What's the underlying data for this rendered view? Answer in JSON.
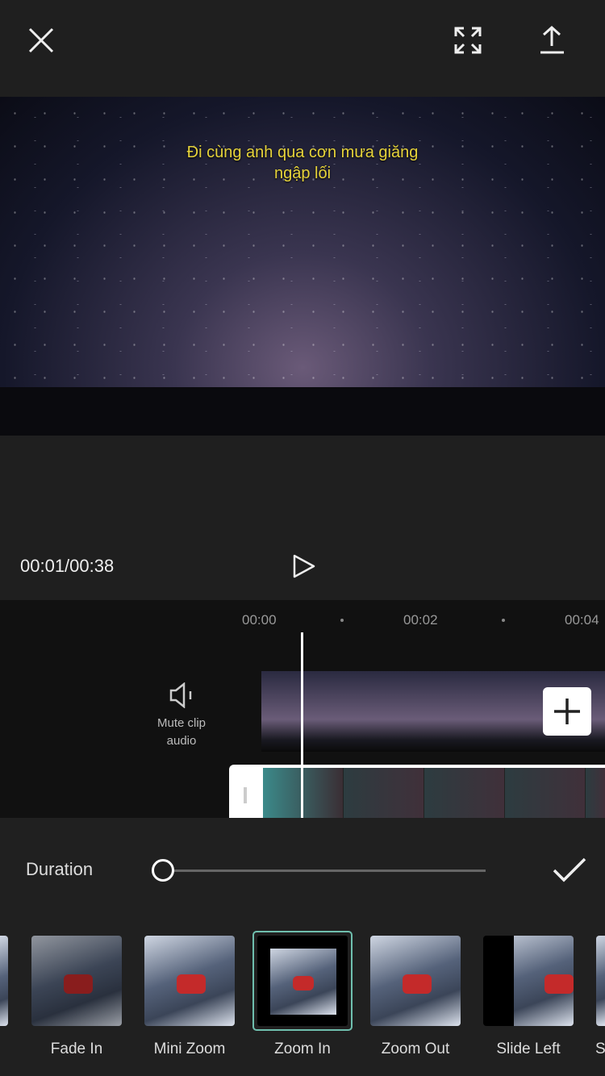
{
  "header": {
    "close_icon": "close-icon",
    "fullscreen_icon": "fullscreen-icon",
    "export_icon": "upload-icon"
  },
  "preview": {
    "caption_line1": "Đi cùng anh qua cơn mưa giăng",
    "caption_line2": "ngập lối"
  },
  "playback": {
    "time": "00:01/00:38",
    "play_icon": "play-icon"
  },
  "timeline": {
    "ticks": [
      "00:00",
      "00:02",
      "00:04"
    ],
    "mute_label_1": "Mute clip",
    "mute_label_2": "audio",
    "add_icon": "plus-icon"
  },
  "duration": {
    "label": "Duration",
    "slider_value": 0
  },
  "animations": [
    {
      "label": ""
    },
    {
      "label": "Fade In"
    },
    {
      "label": "Mini Zoom"
    },
    {
      "label": "Zoom In",
      "selected": true
    },
    {
      "label": "Zoom Out"
    },
    {
      "label": "Slide Left"
    },
    {
      "label": "S"
    }
  ],
  "colors": {
    "selected_border": "#6fbfae",
    "caption": "#e6d33a"
  }
}
